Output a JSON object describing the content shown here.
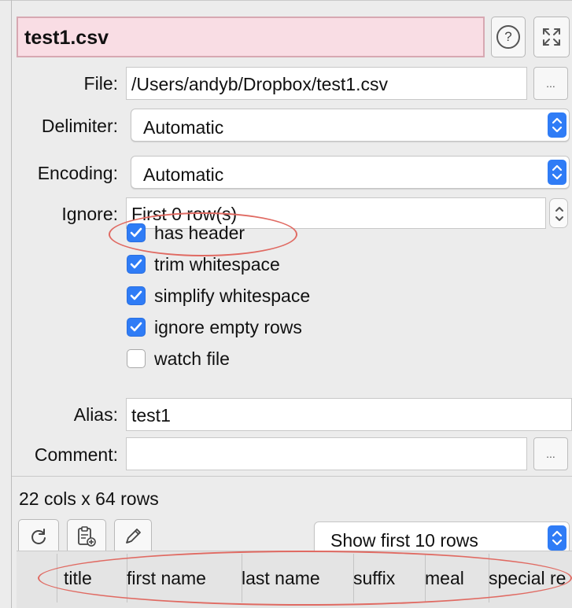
{
  "panel": {
    "title": "test1.csv",
    "help_icon_label": "?",
    "file": {
      "label": "File:",
      "value": "/Users/andyb/Dropbox/test1.csv",
      "browse_label": "..."
    },
    "delimiter": {
      "label": "Delimiter:",
      "value": "Automatic"
    },
    "encoding": {
      "label": "Encoding:",
      "value": "Automatic"
    },
    "ignore": {
      "label": "Ignore:",
      "value": "First 0 row(s)"
    },
    "options": [
      {
        "label": "has header",
        "checked": true
      },
      {
        "label": "trim whitespace",
        "checked": true
      },
      {
        "label": "simplify whitespace",
        "checked": true
      },
      {
        "label": "ignore empty rows",
        "checked": true
      },
      {
        "label": "watch file",
        "checked": false
      }
    ],
    "alias": {
      "label": "Alias:",
      "value": "test1"
    },
    "comment": {
      "label": "Comment:",
      "value": "",
      "browse_label": "..."
    },
    "summary": "22 cols x 64 rows",
    "show_rows": "Show first 10 rows",
    "columns": [
      "title",
      "first name",
      "last name",
      "suffix",
      "meal",
      "special re"
    ]
  },
  "colors": {
    "title_background": "#f9dde4",
    "accent": "#2f7cf6",
    "annotation": "#e06a62"
  }
}
